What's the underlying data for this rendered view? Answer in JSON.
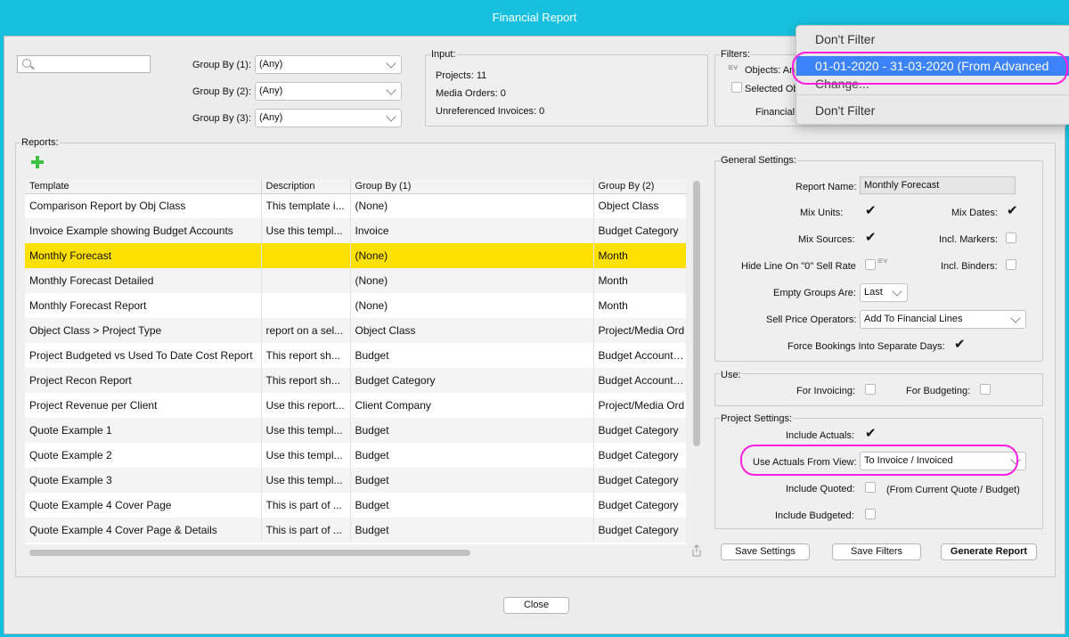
{
  "window": {
    "title": "Financial Report"
  },
  "search": {
    "placeholder": ""
  },
  "group_by": [
    {
      "label": "Group By (1):",
      "value": "(Any)"
    },
    {
      "label": "Group By (2):",
      "value": "(Any)"
    },
    {
      "label": "Group By (3):",
      "value": "(Any)"
    }
  ],
  "input": {
    "title": "Input:",
    "projects": "Projects: 11",
    "media_orders": "Media Orders: 0",
    "unreferenced_invoices": "Unreferenced Invoices: 0"
  },
  "filters": {
    "title": "Filters:",
    "objects": "Objects: An",
    "selected_objects": "Selected Ob",
    "financial": "Financial"
  },
  "filter_dropdown": {
    "items": [
      "Don't Filter",
      "01-01-2020 - 31-03-2020 (From Advanced",
      "Change...",
      "Don't Filter"
    ]
  },
  "reports": {
    "title": "Reports:",
    "columns": [
      "Template",
      "Description",
      "Group By (1)",
      "Group By (2)"
    ],
    "rows": [
      [
        "Comparison Report by Obj Class",
        "This template i...",
        "(None)",
        "Object Class"
      ],
      [
        "Invoice Example showing Budget Accounts",
        "Use this templ...",
        "Invoice",
        "Budget Category"
      ],
      [
        "Monthly Forecast",
        "",
        "(None)",
        "Month"
      ],
      [
        "Monthly Forecast Detailed",
        "",
        "(None)",
        "Month"
      ],
      [
        "Monthly Forecast Report",
        "",
        "(None)",
        "Month"
      ],
      [
        "Object Class > Project Type",
        "report on a sel...",
        "Object Class",
        "Project/Media Ord"
      ],
      [
        "Project Budgeted vs Used To Date Cost Report",
        "This report sh...",
        "Budget",
        "Budget Account (A"
      ],
      [
        "Project Recon Report",
        "This report sh...",
        "Budget Category",
        "Budget Account (N"
      ],
      [
        "Project Revenue per Client",
        "Use this report...",
        "Client Company",
        "Project/Media Ord"
      ],
      [
        "Quote Example 1",
        "Use this templ...",
        "Budget",
        "Budget Category"
      ],
      [
        "Quote Example 2",
        "Use this templ...",
        "Budget",
        "Budget Category"
      ],
      [
        "Quote Example 3",
        "Use this templ...",
        "Budget",
        "Budget Category"
      ],
      [
        "Quote Example 4 Cover Page",
        "This is part of ...",
        "Budget",
        "Budget Category"
      ],
      [
        "Quote Example 4 Cover Page & Details",
        "This is part of ...",
        "Budget",
        "Budget Category"
      ]
    ],
    "selected_row": 2
  },
  "general_settings": {
    "title": "General Settings:",
    "report_name_label": "Report Name:",
    "report_name": "Monthly Forecast",
    "mix_units": "Mix Units:",
    "mix_dates": "Mix Dates:",
    "mix_sources": "Mix Sources:",
    "incl_markers": "Incl. Markers:",
    "hide_line": "Hide Line On \"0\" Sell Rate",
    "incl_binders": "Incl. Binders:",
    "empty_groups_label": "Empty Groups Are:",
    "empty_groups_value": "Last",
    "sell_price_label": "Sell Price Operators:",
    "sell_price_value": "Add To Financial Lines",
    "force_bookings": "Force Bookings Into Separate Days:"
  },
  "use": {
    "title": "Use:",
    "for_invoicing": "For Invoicing:",
    "for_budgeting": "For Budgeting:"
  },
  "project_settings": {
    "title": "Project Settings:",
    "include_actuals": "Include Actuals:",
    "use_actuals_label": "Use Actuals From View:",
    "use_actuals_value": "To Invoice / Invoiced",
    "include_quoted": "Include Quoted:",
    "include_quoted_note": "(From Current Quote / Budget)",
    "include_budgeted": "Include Budgeted:"
  },
  "buttons": {
    "save_settings": "Save Settings",
    "save_filters": "Save Filters",
    "generate_report": "Generate Report",
    "close": "Close"
  },
  "colors": {
    "accent": "#17c1dd",
    "selection": "#ffe100",
    "highlight": "#ff1de0",
    "menu_active": "#3b83f6"
  }
}
